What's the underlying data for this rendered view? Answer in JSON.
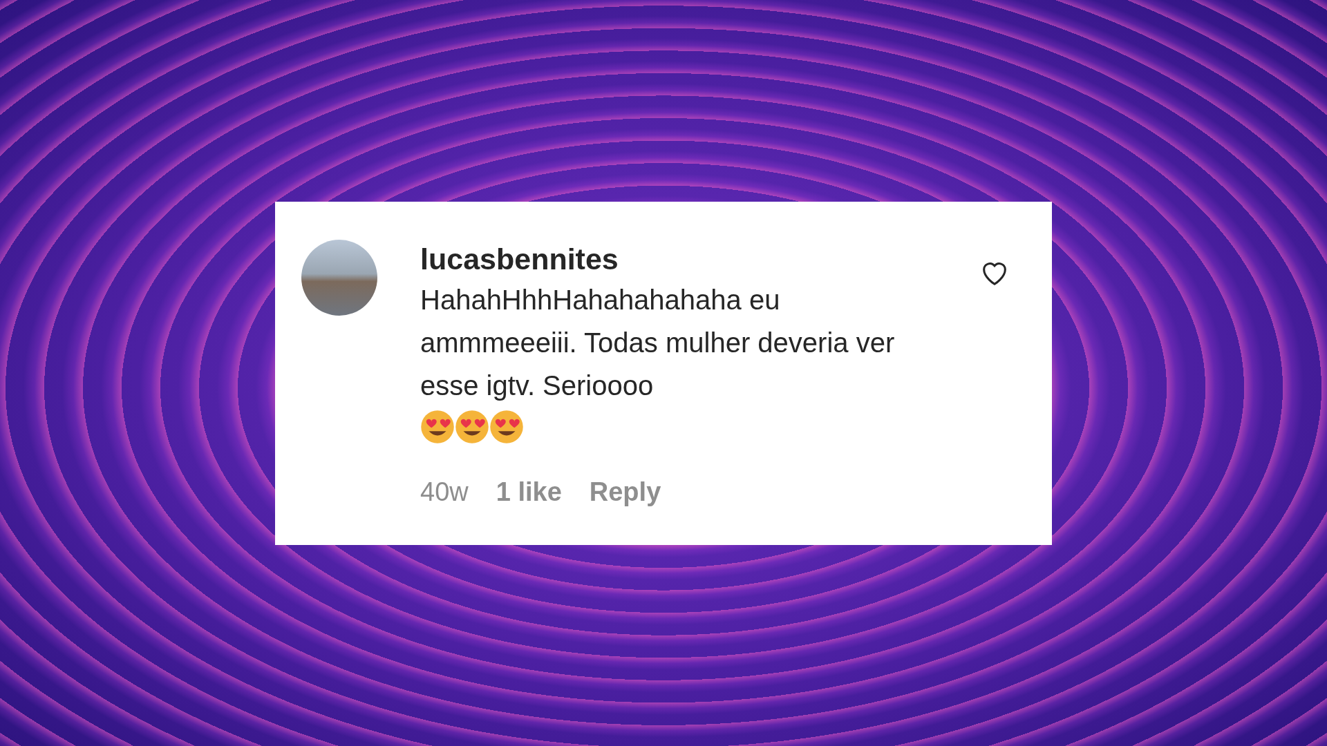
{
  "comment": {
    "username": "lucasbennites",
    "text": "HahahHhhHahahahahaha eu ammmeeeiii. Todas mulher deveria ver esse igtv. Serioooo",
    "emojis": [
      {
        "kind": "heart-eyes"
      },
      {
        "kind": "heart-eyes"
      },
      {
        "kind": "heart-eyes"
      }
    ],
    "liked": false,
    "age": "40w",
    "likes": "1 like",
    "reply": "Reply"
  }
}
